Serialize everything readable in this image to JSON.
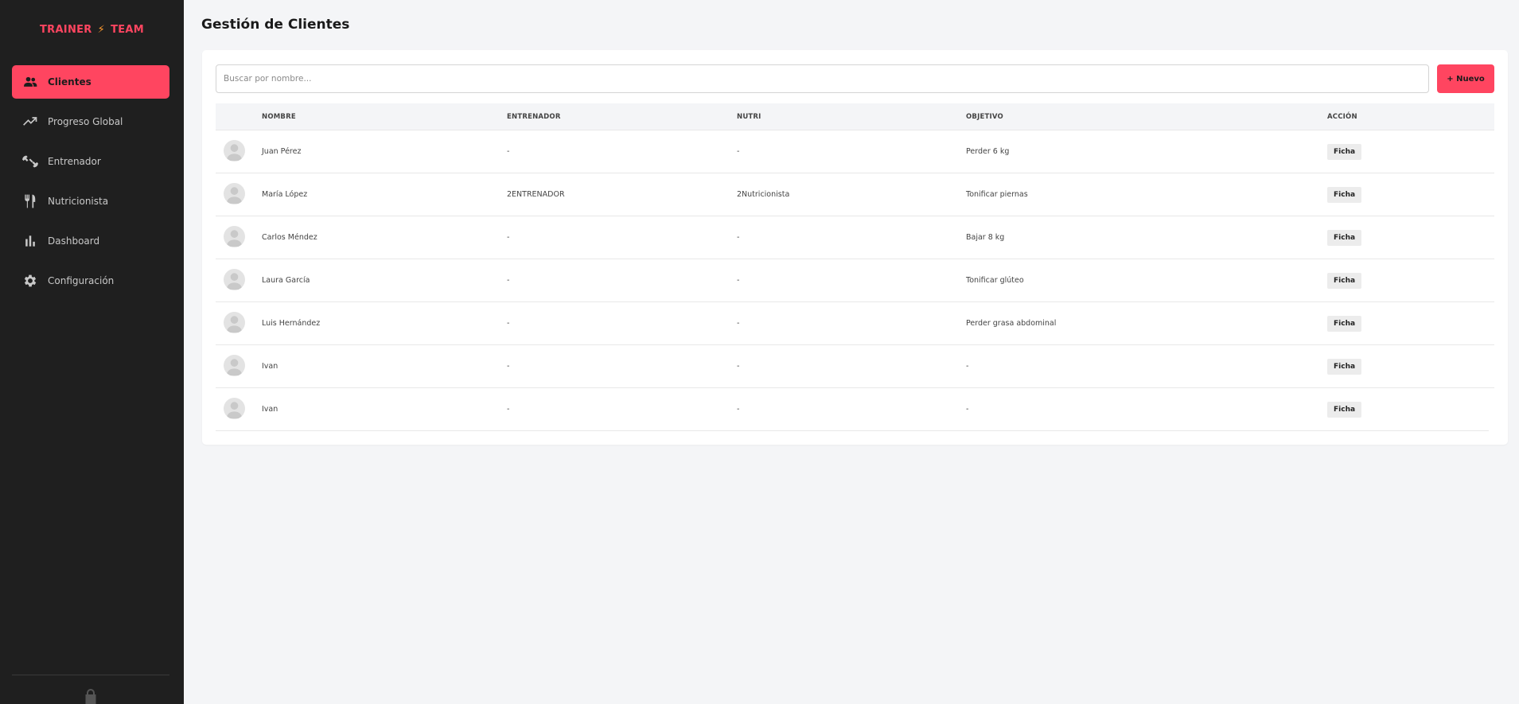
{
  "brand": {
    "left": "TRAINER",
    "right": "TEAM"
  },
  "sidebar": {
    "items": [
      {
        "label": "Clientes",
        "icon": "users-icon",
        "active": true
      },
      {
        "label": "Progreso Global",
        "icon": "trending-up-icon",
        "active": false
      },
      {
        "label": "Entrenador",
        "icon": "dumbbell-icon",
        "active": false
      },
      {
        "label": "Nutricionista",
        "icon": "cutlery-icon",
        "active": false
      },
      {
        "label": "Dashboard",
        "icon": "bar-chart-icon",
        "active": false
      },
      {
        "label": "Configuración",
        "icon": "gear-icon",
        "active": false
      }
    ]
  },
  "page": {
    "title": "Gestión de Clientes"
  },
  "search": {
    "placeholder": "Buscar por nombre...",
    "value": ""
  },
  "actions": {
    "new_label": "+ Nuevo"
  },
  "table": {
    "headers": {
      "name": "NOMBRE",
      "trainer": "ENTRENADOR",
      "nutri": "NUTRI",
      "goal": "OBJETIVO",
      "action": "ACCIÓN"
    },
    "rows": [
      {
        "name": "Juan Pérez",
        "trainer": "-",
        "nutri": "-",
        "goal": "Perder 6 kg",
        "action": "Ficha"
      },
      {
        "name": "María López",
        "trainer": "2ENTRENADOR",
        "nutri": "2Nutricionista",
        "goal": "Tonificar piernas",
        "action": "Ficha"
      },
      {
        "name": "Carlos Méndez",
        "trainer": "-",
        "nutri": "-",
        "goal": "Bajar 8 kg",
        "action": "Ficha"
      },
      {
        "name": "Laura García",
        "trainer": "-",
        "nutri": "-",
        "goal": "Tonificar glúteo",
        "action": "Ficha"
      },
      {
        "name": "Luis Hernández",
        "trainer": "-",
        "nutri": "-",
        "goal": "Perder grasa abdominal",
        "action": "Ficha"
      },
      {
        "name": "Ivan",
        "trainer": "-",
        "nutri": "-",
        "goal": "-",
        "action": "Ficha"
      },
      {
        "name": "Ivan",
        "trainer": "-",
        "nutri": "-",
        "goal": "-",
        "action": "Ficha"
      }
    ]
  },
  "colors": {
    "accent": "#ff4560",
    "sidebar_bg": "#1f1f1f",
    "bolt": "#ff9a2e"
  }
}
